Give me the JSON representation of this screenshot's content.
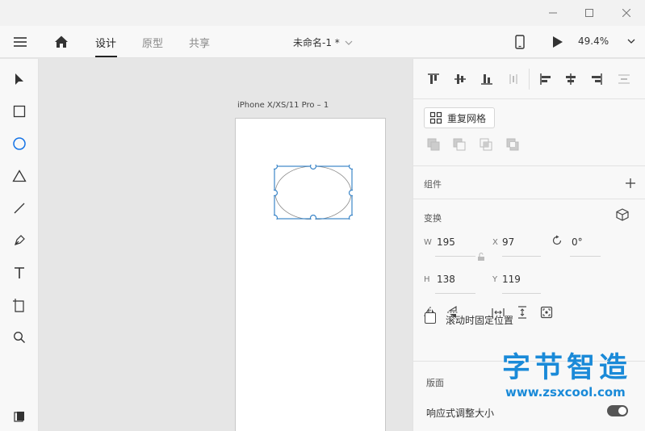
{
  "window": {
    "minimize_icon": "minimize-icon",
    "maximize_icon": "maximize-icon",
    "close_icon": "close-icon"
  },
  "appbar": {
    "tabs": [
      {
        "label": "设计",
        "active": true
      },
      {
        "label": "原型",
        "active": false
      },
      {
        "label": "共享",
        "active": false
      }
    ],
    "document_title": "未命名-1 *",
    "zoom": "49.4%"
  },
  "tools": [
    "select-tool",
    "rectangle-tool",
    "ellipse-tool",
    "triangle-tool",
    "line-tool",
    "pen-tool",
    "text-tool",
    "artboard-tool",
    "zoom-tool",
    "assets-panel"
  ],
  "canvas": {
    "artboard_label": "iPhone X/XS/11 Pro – 1"
  },
  "panel": {
    "repeat_grid_label": "重复网格",
    "components_title": "组件",
    "transform_title": "变换",
    "fields": {
      "w_label": "W",
      "w_value": "195",
      "x_label": "X",
      "x_value": "97",
      "rotation_value": "0°",
      "h_label": "H",
      "h_value": "138",
      "y_label": "Y",
      "y_value": "119"
    },
    "fixed_position_label": "滚动时固定位置",
    "layout_title": "版面",
    "responsive_label": "响应式调整大小",
    "responsive_on": true
  },
  "watermark": {
    "title": "字节智造",
    "url": "www.zsxcool.com"
  },
  "colors": {
    "accent": "#1473e6",
    "selection": "#3d87c9",
    "watermark": "#1a8ad8"
  }
}
